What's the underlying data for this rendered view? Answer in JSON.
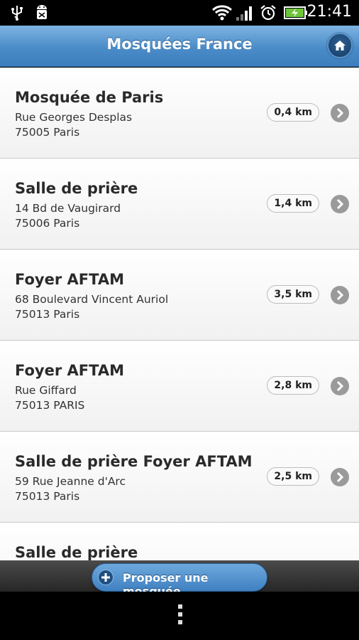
{
  "status_bar": {
    "time": "21:41",
    "icons": [
      "usb-icon",
      "android-debug-icon",
      "wifi-icon",
      "signal-icon",
      "alarm-icon",
      "battery-charging-icon"
    ]
  },
  "header": {
    "title": "Mosquées France",
    "home_icon": "home-icon"
  },
  "mosques": [
    {
      "name": "Mosquée de Paris",
      "street": "Rue Georges Desplas",
      "city": "75005 Paris",
      "distance": "0,4 km"
    },
    {
      "name": "Salle de prière",
      "street": "14 Bd de Vaugirard",
      "city": "75006 Paris",
      "distance": "1,4 km"
    },
    {
      "name": "Foyer AFTAM",
      "street": "68 Boulevard Vincent Auriol",
      "city": "75013 Paris",
      "distance": "3,5 km"
    },
    {
      "name": "Foyer AFTAM",
      "street": "Rue Giffard",
      "city": "75013 PARIS",
      "distance": "2,8 km"
    },
    {
      "name": "Salle de prière Foyer AFTAM",
      "street": "59 Rue Jeanne d'Arc",
      "city": "75013 Paris",
      "distance": "2,5 km"
    },
    {
      "name": "Salle de prière",
      "street": "",
      "city": "",
      "distance": ""
    }
  ],
  "footer": {
    "propose_label": "Proposer une mosquée",
    "plus_icon": "plus-icon"
  },
  "colors": {
    "header_blue": "#4a8cc8",
    "button_blue": "#3f80c1",
    "chevron_gray": "#9a9a9a"
  }
}
